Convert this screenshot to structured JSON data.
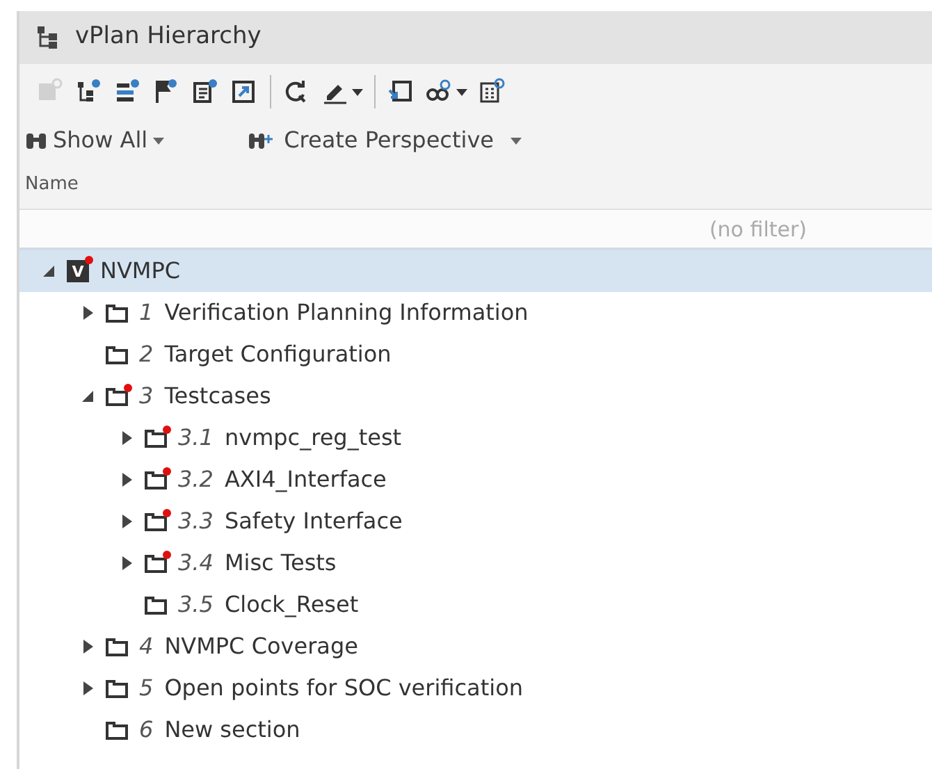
{
  "window": {
    "title": "vPlan Hierarchy"
  },
  "toolbar": {
    "groups": [
      [
        {
          "kind": "new-doc",
          "disabled": true,
          "dropdown": false
        },
        {
          "kind": "add-tree",
          "disabled": false,
          "dropdown": false
        },
        {
          "kind": "add-list",
          "disabled": false,
          "dropdown": false
        },
        {
          "kind": "add-flag",
          "disabled": false,
          "dropdown": false
        },
        {
          "kind": "add-note",
          "disabled": false,
          "dropdown": false
        },
        {
          "kind": "open-box",
          "disabled": false,
          "dropdown": false
        }
      ],
      [
        {
          "kind": "refresh",
          "disabled": false,
          "dropdown": false
        },
        {
          "kind": "pen",
          "disabled": false,
          "dropdown": true
        }
      ],
      [
        {
          "kind": "box-arrows",
          "disabled": false,
          "dropdown": false
        },
        {
          "kind": "link",
          "disabled": false,
          "dropdown": true
        },
        {
          "kind": "grid",
          "disabled": false,
          "dropdown": false
        }
      ]
    ]
  },
  "filter_bar": {
    "show_all": "Show All",
    "create_perspective": "Create Perspective"
  },
  "column": {
    "name": "Name"
  },
  "filter": {
    "placeholder": "(no filter)"
  },
  "tree": [
    {
      "badge": "V",
      "label": "NVMPC",
      "selected": true,
      "marked": true,
      "expanded": true,
      "children": [
        {
          "number": "1",
          "label": "Verification Planning Information",
          "selected": false,
          "marked": false,
          "expanded": false
        },
        {
          "number": "2",
          "label": "Target Configuration",
          "selected": false,
          "marked": false
        },
        {
          "number": "3",
          "label": "Testcases",
          "selected": false,
          "marked": true,
          "expanded": true,
          "children": [
            {
              "number": "3.1",
              "label": "nvmpc_reg_test",
              "selected": false,
              "marked": true,
              "expanded": false
            },
            {
              "number": "3.2",
              "label": "AXI4_Interface",
              "selected": false,
              "marked": true,
              "expanded": false
            },
            {
              "number": "3.3",
              "label": "Safety Interface",
              "selected": false,
              "marked": true,
              "expanded": false
            },
            {
              "number": "3.4",
              "label": "Misc Tests",
              "selected": false,
              "marked": true,
              "expanded": false
            },
            {
              "number": "3.5",
              "label": "Clock_Reset",
              "selected": false,
              "marked": false
            }
          ]
        },
        {
          "number": "4",
          "label": "NVMPC Coverage",
          "selected": false,
          "marked": false,
          "expanded": false
        },
        {
          "number": "5",
          "label": "Open points for SOC verification",
          "selected": false,
          "marked": false,
          "expanded": false
        },
        {
          "number": "6",
          "label": "New section",
          "selected": false,
          "marked": false
        }
      ]
    }
  ]
}
